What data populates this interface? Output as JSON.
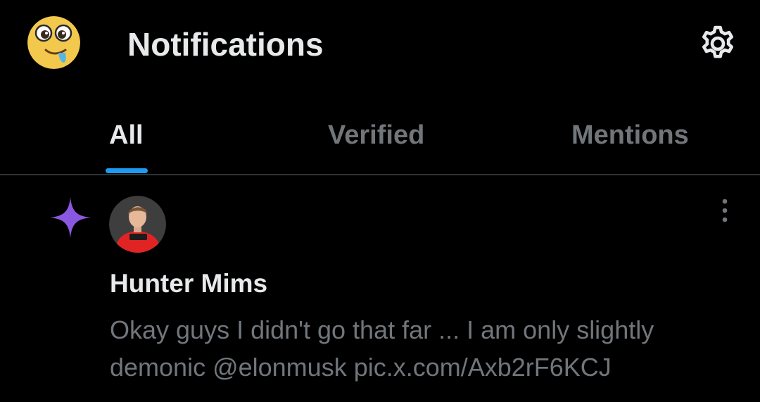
{
  "header": {
    "title": "Notifications",
    "profile_avatar_icon": "drooling-emoji-avatar",
    "settings_icon": "gear-icon"
  },
  "tabs": [
    {
      "label": "All",
      "selected": true
    },
    {
      "label": "Verified",
      "selected": false
    },
    {
      "label": "Mentions",
      "selected": false
    }
  ],
  "notifications": [
    {
      "type_icon": "sparkle-icon",
      "author_name": "Hunter Mims",
      "text_line1": "Okay guys I didn't go that far ... I am only slightly",
      "text_line2": "demonic @elonmusk pic.x.com/Axb2rF6KCJ",
      "more_icon": "more-vertical-icon"
    }
  ],
  "colors": {
    "background": "#000000",
    "primary_text": "#e7e9ea",
    "secondary_text": "#71767b",
    "accent": "#1d9bf0",
    "divider": "#2f3336",
    "sparkle": "#8a58e0"
  }
}
